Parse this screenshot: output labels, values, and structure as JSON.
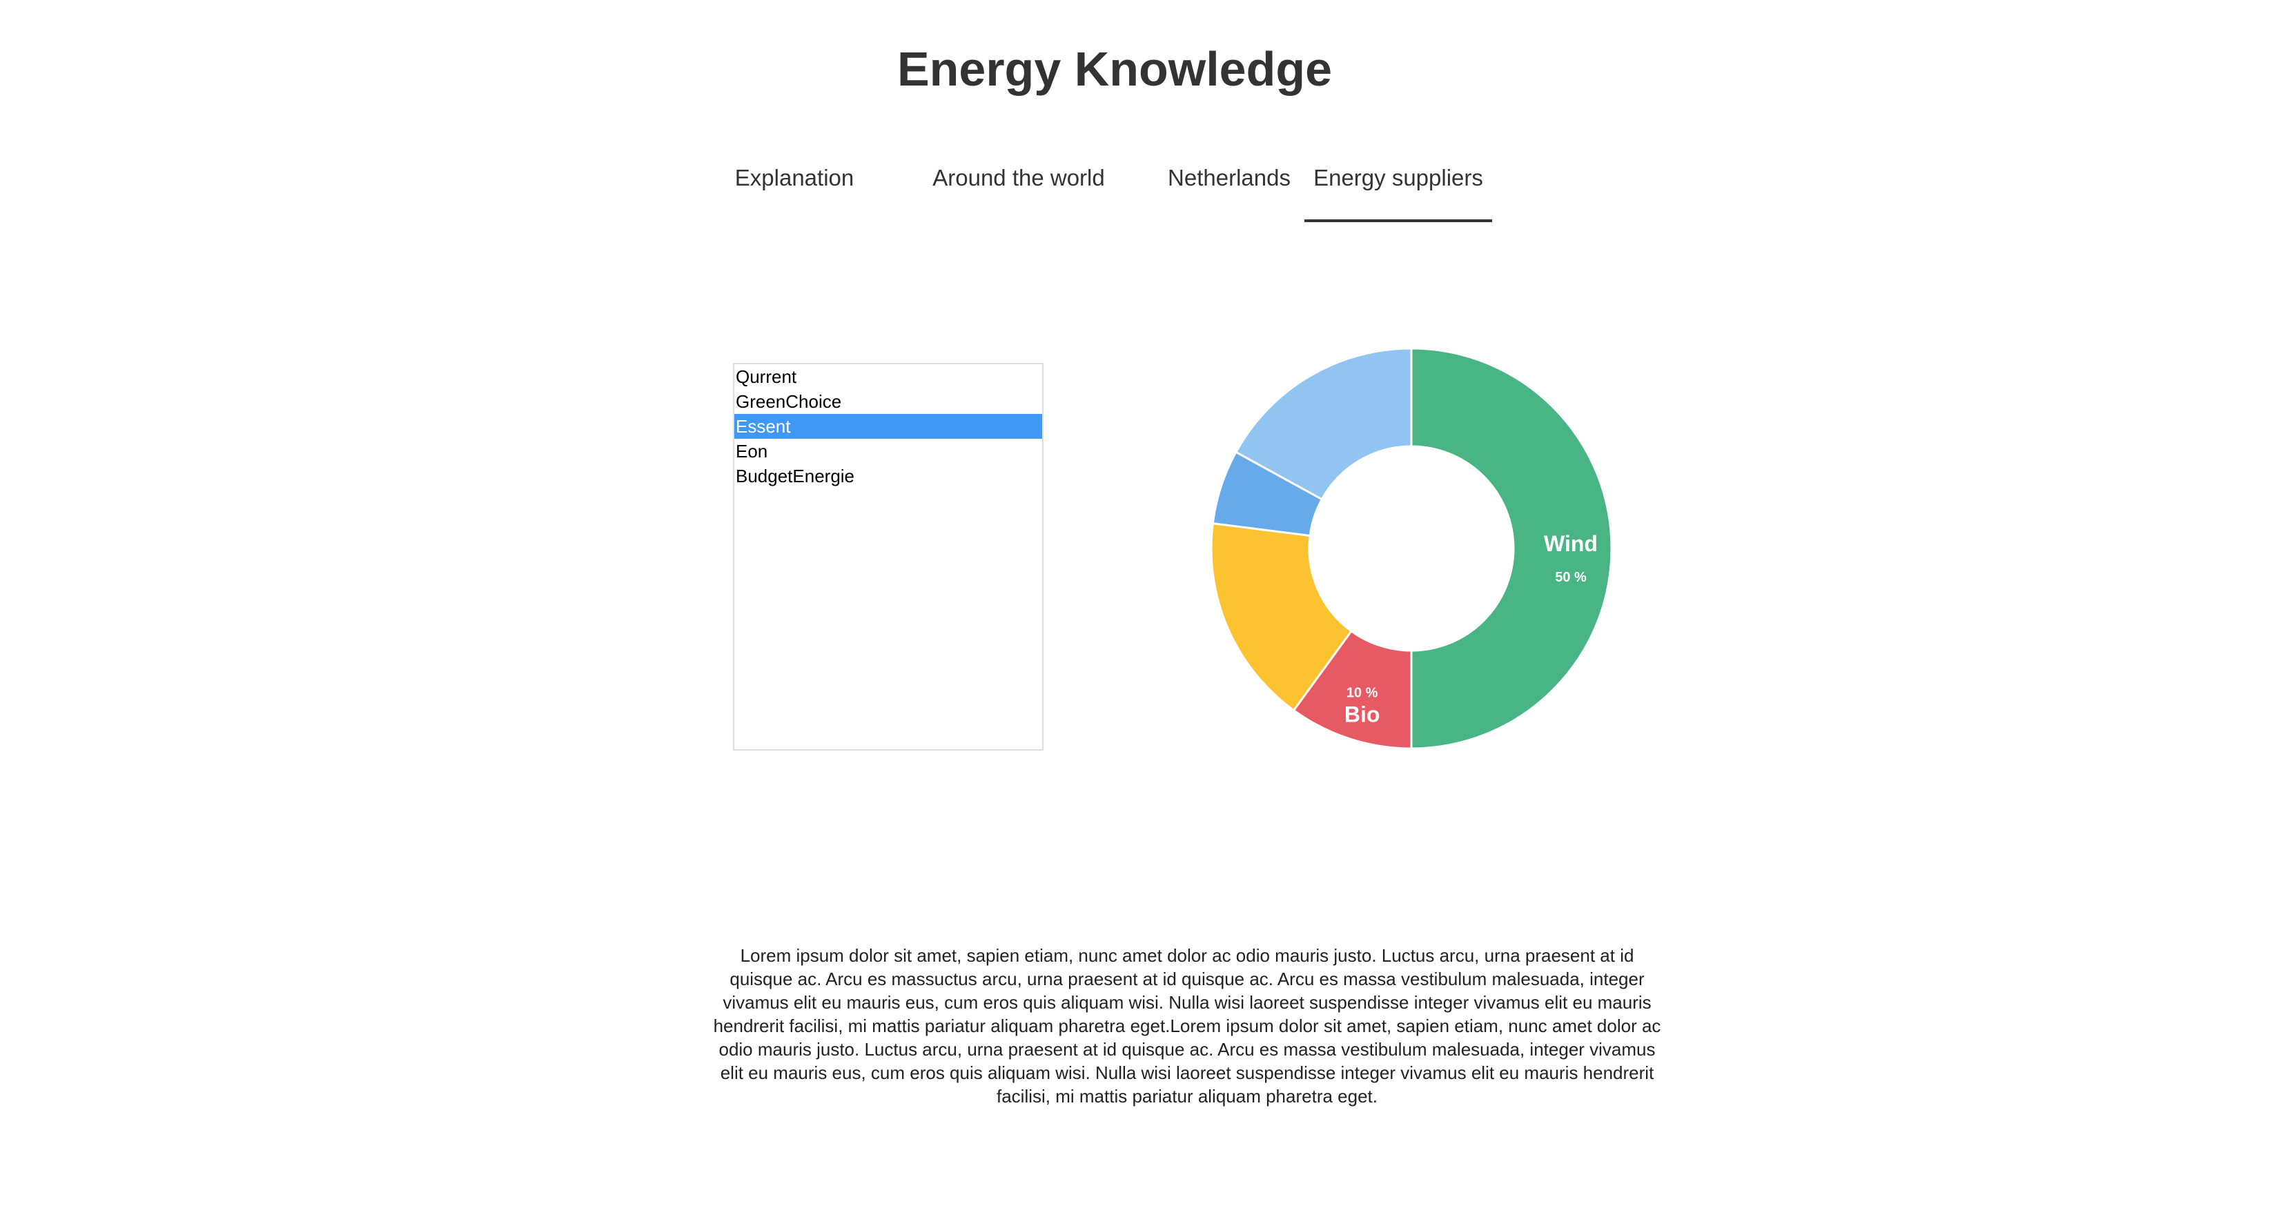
{
  "page": {
    "title": "Energy Knowledge"
  },
  "tabs": [
    {
      "label": "Explanation",
      "active": false
    },
    {
      "label": "Around the world",
      "active": false
    },
    {
      "label": "Netherlands",
      "active": false
    },
    {
      "label": "Energy suppliers",
      "active": true
    }
  ],
  "suppliers": {
    "options": [
      "Qurrent",
      "GreenChoice",
      "Essent",
      "Eon",
      "BudgetEnergie"
    ],
    "selected": "Essent"
  },
  "chart_data": {
    "type": "pie",
    "donut": true,
    "categories": [
      "Wind",
      "Bio",
      "",
      "",
      ""
    ],
    "values": [
      50,
      10,
      17,
      6,
      17
    ],
    "colors": [
      "#4ab584",
      "#e85a63",
      "#fdc22f",
      "#67aaea",
      "#92c4f2"
    ],
    "data_labels": [
      {
        "name": "Wind",
        "value": "50 %"
      },
      {
        "name": "Bio",
        "value": "10 %"
      }
    ]
  },
  "description": {
    "text": "Lorem ipsum dolor sit amet, sapien etiam, nunc amet dolor ac odio mauris justo. Luctus arcu, urna praesent at id quisque ac. Arcu es massuctus arcu, urna praesent at id quisque ac. Arcu es massa vestibulum malesuada, integer vivamus elit eu mauris eus, cum eros quis aliquam wisi. Nulla wisi laoreet suspendisse integer vivamus elit eu mauris hendrerit facilisi, mi mattis pariatur aliquam pharetra eget.Lorem ipsum dolor sit amet, sapien etiam, nunc amet dolor ac odio mauris justo. Luctus arcu, urna praesent at id quisque ac. Arcu es massa vestibulum malesuada, integer vivamus elit eu mauris eus, cum eros quis aliquam wisi. Nulla wisi laoreet suspendisse integer vivamus elit eu mauris hendrerit facilisi, mi mattis pariatur aliquam pharetra eget."
  }
}
